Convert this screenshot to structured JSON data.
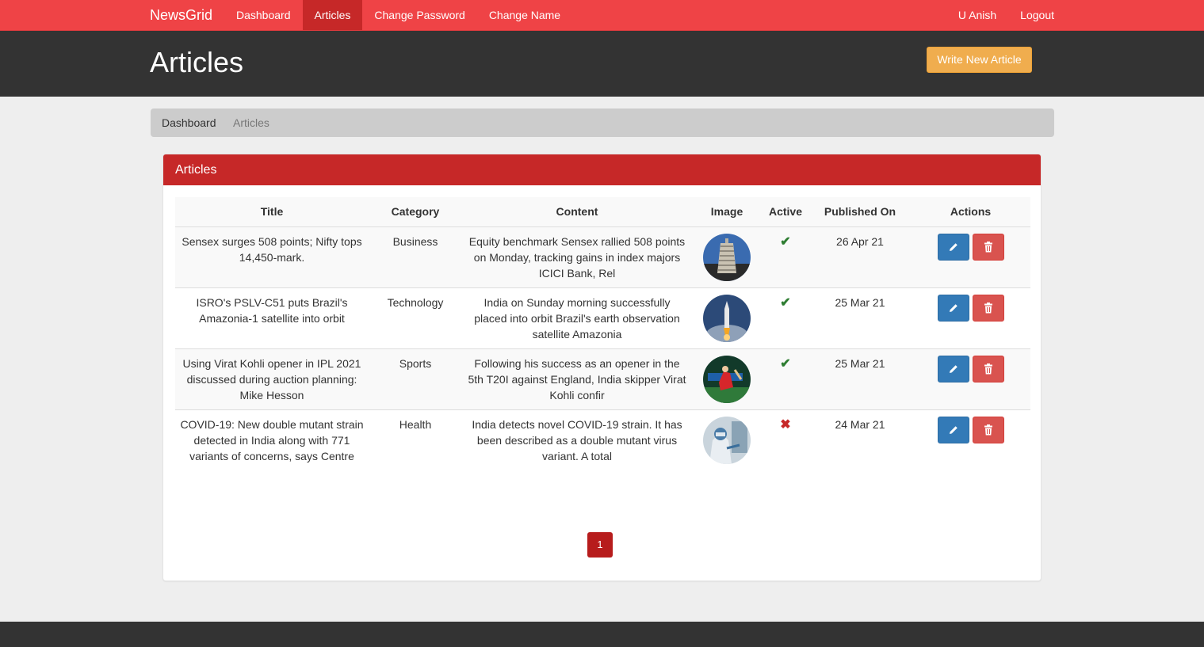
{
  "nav": {
    "brand": "NewsGrid",
    "links": [
      "Dashboard",
      "Articles",
      "Change Password",
      "Change Name"
    ],
    "active": "Articles",
    "user": "U Anish",
    "logout": "Logout"
  },
  "header": {
    "title": "Articles",
    "write_button": "Write New Article"
  },
  "breadcrumb": [
    "Dashboard",
    "Articles"
  ],
  "panel": {
    "title": "Articles",
    "columns": [
      "Title",
      "Category",
      "Content",
      "Image",
      "Active",
      "Published On",
      "Actions"
    ],
    "rows": [
      {
        "title": "Sensex surges 508 points; Nifty tops 14,450-mark.",
        "category": "Business",
        "content": "Equity benchmark Sensex rallied 508 points on Monday, tracking gains in index majors ICICI Bank, Rel",
        "active": true,
        "published": "26 Apr 21"
      },
      {
        "title": "ISRO's PSLV-C51 puts Brazil's Amazonia-1 satellite into orbit",
        "category": "Technology",
        "content": "India on Sunday morning successfully placed into orbit Brazil's earth observation satellite Amazonia",
        "active": true,
        "published": "25 Mar 21"
      },
      {
        "title": "Using Virat Kohli opener in IPL 2021 discussed during auction planning: Mike Hesson",
        "category": "Sports",
        "content": "Following his success as an opener in the 5th T20I against England, India skipper Virat Kohli confir",
        "active": true,
        "published": "25 Mar 21"
      },
      {
        "title": "COVID-19: New double mutant strain detected in India along with 771 variants of concerns, says Centre",
        "category": "Health",
        "content": "India detects novel COVID-19 strain. It has been described as a double mutant virus variant. A total",
        "active": false,
        "published": "24 Mar 21"
      }
    ],
    "current_page": "1"
  },
  "icons": {
    "active_true": "check-icon",
    "active_false": "cross-icon",
    "edit": "pencil-icon",
    "delete": "trash-icon"
  },
  "colors": {
    "navbar": "#ef4346",
    "nav_active": "#c62828",
    "header": "#333333",
    "write_button": "#f0ad4e",
    "panel_heading": "#c62828",
    "edit_button": "#337ab7",
    "delete_button": "#d9534f",
    "pager_active": "#b71c1c"
  }
}
